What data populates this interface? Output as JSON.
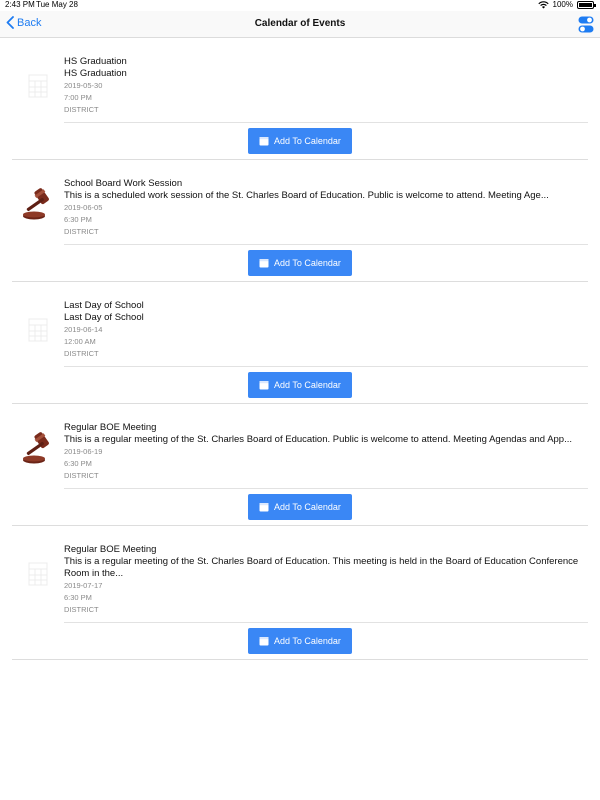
{
  "status_bar": {
    "time": "2:43 PM",
    "date": "Tue May 28",
    "battery": "100%"
  },
  "nav": {
    "back_label": "Back",
    "title": "Calendar of Events"
  },
  "add_button_label": "Add To Calendar",
  "events": [
    {
      "title": "HS Graduation",
      "description": "HS Graduation",
      "date": "2019-05-30",
      "time": "7:00 PM",
      "category": "DISTRICT",
      "thumbnail": "calendar-grid-icon"
    },
    {
      "title": "School Board Work Session",
      "description": "This is a scheduled work session of the St. Charles Board of Education.  Public is welcome to attend.  Meeting Age...",
      "date": "2019-06-05",
      "time": "6:30 PM",
      "category": "DISTRICT",
      "thumbnail": "gavel-icon"
    },
    {
      "title": "Last Day of School",
      "description": "Last Day of School",
      "date": "2019-06-14",
      "time": "12:00 AM",
      "category": "DISTRICT",
      "thumbnail": "calendar-grid-icon"
    },
    {
      "title": "Regular BOE Meeting",
      "description": "This is a regular meeting of the St. Charles Board of Education.  Public is welcome to attend.  Meeting Agendas and App...",
      "date": "2019-06-19",
      "time": "6:30 PM",
      "category": "DISTRICT",
      "thumbnail": "gavel-icon"
    },
    {
      "title": "Regular BOE Meeting",
      "description": "This is a regular meeting of the St. Charles Board of Education. This meeting is held in the Board of Education Conference Room in the...",
      "date": "2019-07-17",
      "time": "6:30 PM",
      "category": "DISTRICT",
      "thumbnail": "calendar-grid-icon"
    }
  ],
  "colors": {
    "accent": "#1e7cf2",
    "button": "#3a87f5",
    "meta_text": "#8a8a8a"
  }
}
